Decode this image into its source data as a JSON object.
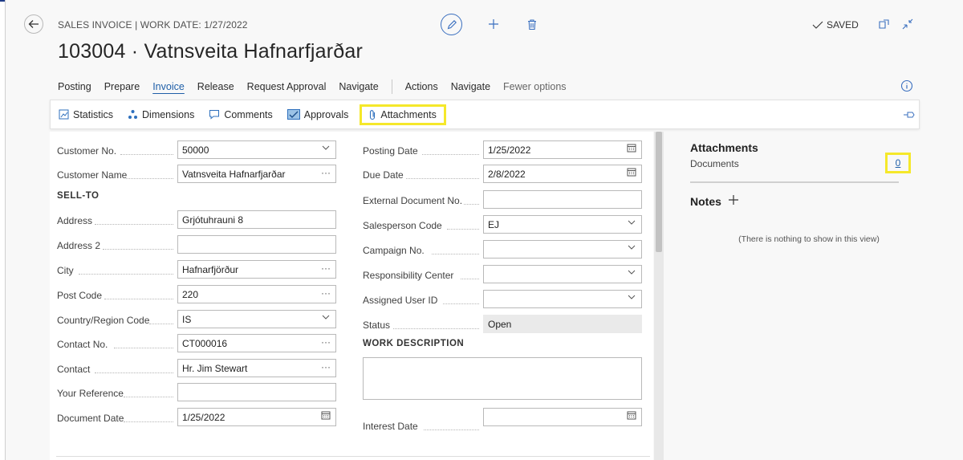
{
  "header": {
    "breadcrumb": "SALES INVOICE | WORK DATE: 1/27/2022",
    "title": "103004 · Vatnsveita Hafnarfjarðar",
    "saved": "SAVED"
  },
  "menu": {
    "items": [
      "Posting",
      "Prepare",
      "Invoice",
      "Release",
      "Request Approval",
      "Navigate"
    ],
    "items2": [
      "Actions",
      "Navigate",
      "Fewer options"
    ]
  },
  "actions": {
    "statistics": "Statistics",
    "dimensions": "Dimensions",
    "comments": "Comments",
    "approvals": "Approvals",
    "attachments": "Attachments"
  },
  "form": {
    "section_sell_to": "SELL-TO",
    "section_work": "WORK DESCRIPTION",
    "left": [
      {
        "label": "Customer No.",
        "value": "50000",
        "suffix": "⌵"
      },
      {
        "label": "Customer Name",
        "value": "Vatnsveita Hafnarfjarðar",
        "suffix": "···"
      },
      {
        "label": "Address",
        "value": "Grjótuhrauni 8",
        "suffix": ""
      },
      {
        "label": "Address 2",
        "value": "",
        "suffix": ""
      },
      {
        "label": "City",
        "value": "Hafnarfjörður",
        "suffix": "···"
      },
      {
        "label": "Post Code",
        "value": "220",
        "suffix": "···"
      },
      {
        "label": "Country/Region Code",
        "value": "IS",
        "suffix": "⌵"
      },
      {
        "label": "Contact No.",
        "value": "CT000016",
        "suffix": "···"
      },
      {
        "label": "Contact",
        "value": "Hr. Jim Stewart",
        "suffix": "···"
      },
      {
        "label": "Your Reference",
        "value": "",
        "suffix": ""
      },
      {
        "label": "Document Date",
        "value": "1/25/2022",
        "suffix": "cal"
      }
    ],
    "right": [
      {
        "label": "Posting Date",
        "value": "1/25/2022",
        "suffix": "cal"
      },
      {
        "label": "Due Date",
        "value": "2/8/2022",
        "suffix": "cal"
      },
      {
        "label": "External Document No.",
        "value": "",
        "suffix": ""
      },
      {
        "label": "Salesperson Code",
        "value": "EJ",
        "suffix": "⌵"
      },
      {
        "label": "Campaign No.",
        "value": "",
        "suffix": "⌵"
      },
      {
        "label": "Responsibility Center",
        "value": "",
        "suffix": "⌵"
      },
      {
        "label": "Assigned User ID",
        "value": "",
        "suffix": "⌵"
      },
      {
        "label": "Status",
        "value": "Open",
        "suffix": ""
      },
      {
        "label": "Interest Date",
        "value": "",
        "suffix": "cal"
      }
    ]
  },
  "factbox": {
    "title": "Attachments",
    "documents_label": "Documents",
    "documents_count": "0",
    "notes_title": "Notes",
    "notes_empty": "(There is nothing to show in this view)"
  },
  "colors": {
    "accent": "#1f5fa8",
    "highlight": "#f5e82a"
  }
}
